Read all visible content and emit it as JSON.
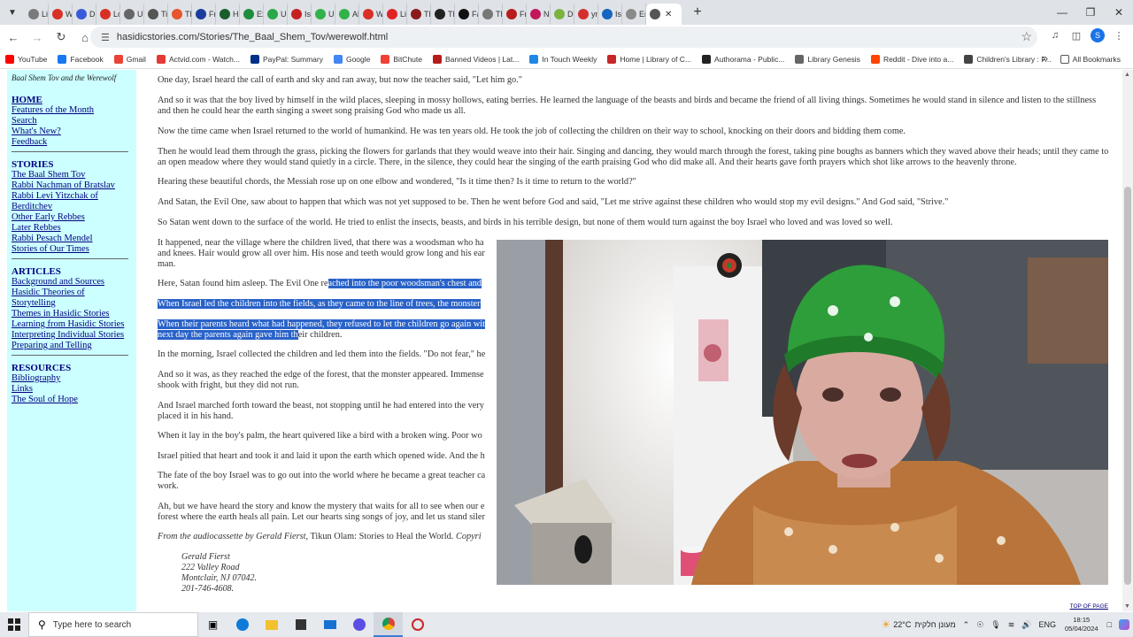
{
  "browser": {
    "tabs": [
      {
        "label": "Lib",
        "color": "#7a7a7a"
      },
      {
        "label": "Wi",
        "color": "#d93025"
      },
      {
        "label": "De",
        "color": "#3a5bd9"
      },
      {
        "label": "Lo",
        "color": "#d93025"
      },
      {
        "label": "Ub",
        "color": "#666666"
      },
      {
        "label": "Tim",
        "color": "#555555"
      },
      {
        "label": "Th",
        "color": "#e8542c"
      },
      {
        "label": "Fre",
        "color": "#1b3c9c"
      },
      {
        "label": "Ho",
        "color": "#1a5e2a"
      },
      {
        "label": "Ex",
        "color": "#1e8e3e"
      },
      {
        "label": "Un",
        "color": "#2aa84a"
      },
      {
        "label": "Isr",
        "color": "#c5221f"
      },
      {
        "label": "Up",
        "color": "#33b249"
      },
      {
        "label": "All",
        "color": "#33b249"
      },
      {
        "label": "Wi",
        "color": "#d93025"
      },
      {
        "label": "Liv",
        "color": "#e02424"
      },
      {
        "label": "Th",
        "color": "#8b1a1a"
      },
      {
        "label": "Th",
        "color": "#222222"
      },
      {
        "label": "Fa",
        "color": "#111111"
      },
      {
        "label": "Th",
        "color": "#777777"
      },
      {
        "label": "Fro",
        "color": "#b71c1c"
      },
      {
        "label": "Ne",
        "color": "#c2185b"
      },
      {
        "label": "De",
        "color": "#7cb342"
      },
      {
        "label": "ym",
        "color": "#d32f2f"
      },
      {
        "label": "Is",
        "color": "#1565c0"
      },
      {
        "label": "Err",
        "color": "#8a8a8a"
      }
    ],
    "active_tab": {
      "color": "#555555"
    },
    "url": "hasidicstories.com/Stories/The_Baal_Shem_Tov/werewolf.html",
    "bookmarks": [
      {
        "label": "YouTube",
        "color": "#ff0000"
      },
      {
        "label": "Facebook",
        "color": "#1877f2"
      },
      {
        "label": "Gmail",
        "color": "#ea4335"
      },
      {
        "label": "Actvid.com - Watch...",
        "color": "#e53935"
      },
      {
        "label": "PayPal: Summary",
        "color": "#003087"
      },
      {
        "label": "Google",
        "color": "#4285f4"
      },
      {
        "label": "BitChute",
        "color": "#ef4136"
      },
      {
        "label": "Banned Videos | Lat...",
        "color": "#b71c1c"
      },
      {
        "label": "In Touch Weekly",
        "color": "#1e88e5"
      },
      {
        "label": "Home | Library of C...",
        "color": "#c62828"
      },
      {
        "label": "Authorama - Public...",
        "color": "#222222"
      },
      {
        "label": "Library Genesis",
        "color": "#666666"
      },
      {
        "label": "Reddit - Dive into a...",
        "color": "#ff4500"
      },
      {
        "label": "Children's Library : F...",
        "color": "#444444"
      }
    ],
    "all_bookmarks": "All Bookmarks"
  },
  "sidebar": {
    "title": "Baal Shem Tov and the Werewolf",
    "home": "HOME",
    "main_links": [
      "Features of the Month",
      "Search",
      "What's New?",
      "Feedback"
    ],
    "stories_head": "STORIES",
    "stories": [
      "The Baal Shem Tov",
      "Rabbi Nachman of Bratslav",
      "Rabbi Levi Yitzchak of",
      "Berditchev",
      "Other Early Rebbes",
      "Later Rebbes",
      "Rabbi Pesach Mendel",
      "Stories of Our Times"
    ],
    "articles_head": "ARTICLES",
    "articles": [
      "Background and Sources",
      "Hasidic Theories of",
      "Storytelling",
      "Themes in Hasidic Stories",
      "Learning from Hasidic Stories",
      "Interpreting Individual Stories",
      "Preparing and Telling"
    ],
    "resources_head": "RESOURCES",
    "resources": [
      "Bibliography",
      "Links",
      "The Soul of Hope"
    ]
  },
  "content": {
    "p1": "One day, Israel heard the call of earth and sky and ran away, but now the teacher said, \"Let him go.\"",
    "p2": "And so it was that the boy lived by himself in the wild places, sleeping in mossy hollows, eating berries. He learned the language of the beasts and birds and became the friend of all living things. Sometimes he would stand in silence and listen to the stillness and then he could hear the earth singing a sweet song praising God who made us all.",
    "p3": "Now the time came when Israel returned to the world of humankind. He was ten years old. He took the job of collecting the children on their way to school, knocking on their doors and bidding them come.",
    "p4": "Then he would lead them through the grass, picking the flowers for garlands that they would weave into their hair. Singing and dancing, they would march through the forest, taking pine boughs as banners which they waved above their heads; until they came to an open meadow where they would stand quietly in a circle. There, in the silence, they could hear the singing of the earth praising God who did make all. And their hearts gave forth prayers which shot like arrows to the heavenly throne.",
    "p5": "Hearing these beautiful chords, the Messiah rose up on one elbow and wondered, \"Is it time then? Is it time to return to the world?\"",
    "p6": "And Satan, the Evil One, saw about to happen that which was not yet supposed to be. Then he went before God and said, \"Let me strive against these children who would stop my evil designs.\" And God said, \"Strive.\"",
    "p7": "So Satan went down to the surface of the world. He tried to enlist the insects, beasts, and birds in his terrible design, but none of them would turn against the boy Israel who loved and was loved so well.",
    "p8a": "It happened, near the village where the children lived, that there was a woodsman who ha",
    "p8b": "and knees. Hair would grow all over him. His nose and teeth would grow long and his ear",
    "p8c": "man.",
    "p9a": "Here, Satan found him asleep. The Evil One re",
    "p9b": "ached into the poor woodsman's chest and",
    "p10": "When Israel led the children into the fields, as they came to the line of trees, the monster",
    "p11a": "When their parents heard what had happened, they refused to let the children go again wit",
    "p11b": "next day the parents again gave him th",
    "p11c": "eir children.",
    "p12": "In the morning, Israel collected the children and led them into the fields. \"Do not fear,\" he",
    "p13a": "And so it was, as they reached the edge of the forest, that the monster appeared. Immense",
    "p13b": "shook with fright, but they did not run.",
    "p14a": "And Israel marched forth toward the beast, not stopping until he had entered into the very",
    "p14b": "placed it in his hand.",
    "p15": "When it lay in the boy's palm, the heart quivered like a bird with a broken wing. Poor wo",
    "p16": "Israel pitied that heart and took it and laid it upon the earth which opened wide. And the h",
    "p17a": "The fate of the boy Israel was to go out into the world where he became a great teacher ca",
    "p17b": "work.",
    "p18a": "Ah, but we have heard the story and know the mystery that waits for all to see when our e",
    "p18b": "forest where the earth heals all pain. Let our hearts sing songs of joy, and let us stand siler",
    "citation_a": "From the audiocassette by Gerald Fierst,",
    "citation_b": " Tikun Olam: Stories to Heal the World.",
    "citation_c": " Copyri",
    "address": [
      "Gerald Fierst",
      "222 Valley Road",
      "Montclair, NJ 07042.",
      "201-746-4608."
    ],
    "top_of_page": "TOP OF PAGE"
  },
  "taskbar": {
    "search_placeholder": "Type here to search",
    "weather": "22°C",
    "weather_text": "מעונן חלקית",
    "lang": "ENG",
    "time": "18:15",
    "date": "05/04/2024"
  }
}
